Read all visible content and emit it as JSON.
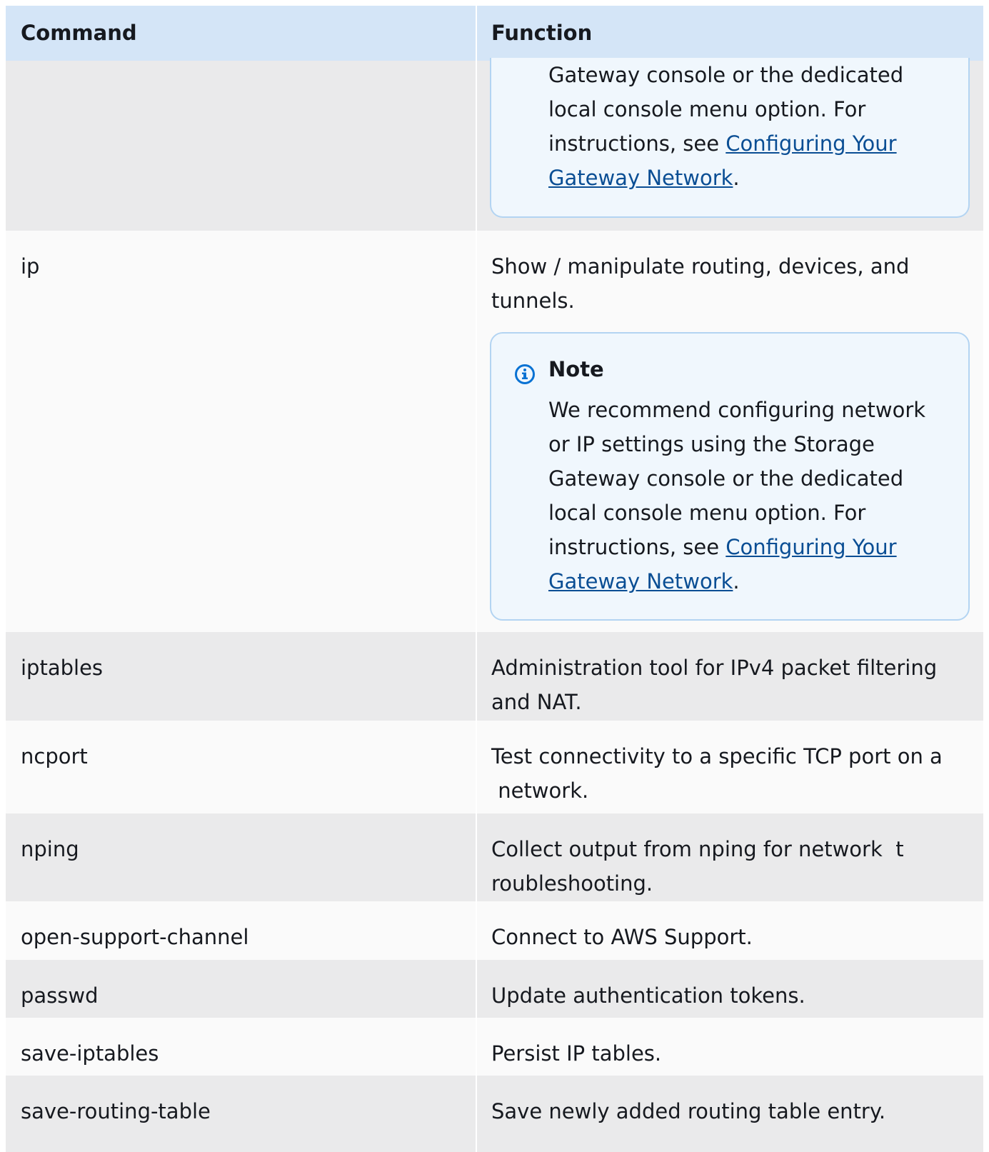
{
  "table": {
    "headers": {
      "command": "Command",
      "function": "Function"
    },
    "top_note": {
      "lines": [
        "Gateway console or the dedicated",
        "local console menu  option. For"
      ],
      "prefix": "instructions, see ",
      "link_part1": "Configuring Your",
      "link_part2": "Gateway Network",
      "suffix": "."
    },
    "ip": {
      "command": "ip",
      "function_lines": [
        "Show / manipulate routing, devices, and",
        "tunnels."
      ],
      "note": {
        "title": "Note",
        "icon": "info-icon",
        "lines": [
          "We recommend configuring network",
          "or IP settings using  the Storage",
          "Gateway console or the dedicated",
          "local console menu  option. For"
        ],
        "prefix": "instructions, see ",
        "link_part1": "Configuring Your",
        "link_part2": "Gateway Network",
        "suffix": "."
      }
    },
    "rows": [
      {
        "command": "iptables",
        "function_lines": [
          "Administration tool for IPv4 packet filtering",
          "and  NAT."
        ]
      },
      {
        "command": "ncport",
        "function_lines": [
          "Test connectivity to a specific TCP port on a",
          " network."
        ]
      },
      {
        "command": "nping",
        "function_lines": [
          "Collect output from nping for network  t",
          "roubleshooting."
        ]
      },
      {
        "command": "open-support-channel",
        "function_lines": [
          "Connect to AWS Support."
        ]
      },
      {
        "command": "passwd",
        "function_lines": [
          "Update authentication tokens."
        ]
      },
      {
        "command": "save-iptables",
        "function_lines": [
          "Persist IP tables."
        ]
      },
      {
        "command": "save-routing-table",
        "function_lines": [
          "Save newly added routing table entry."
        ]
      }
    ]
  },
  "colors": {
    "header_bg": "#d4e5f7",
    "row_gray": "#eaeaeb",
    "row_white": "#fafafa",
    "note_bg": "#f0f7fd",
    "note_border": "#b3d4f2",
    "link": "#0a4e94",
    "info_icon": "#0972d3"
  }
}
